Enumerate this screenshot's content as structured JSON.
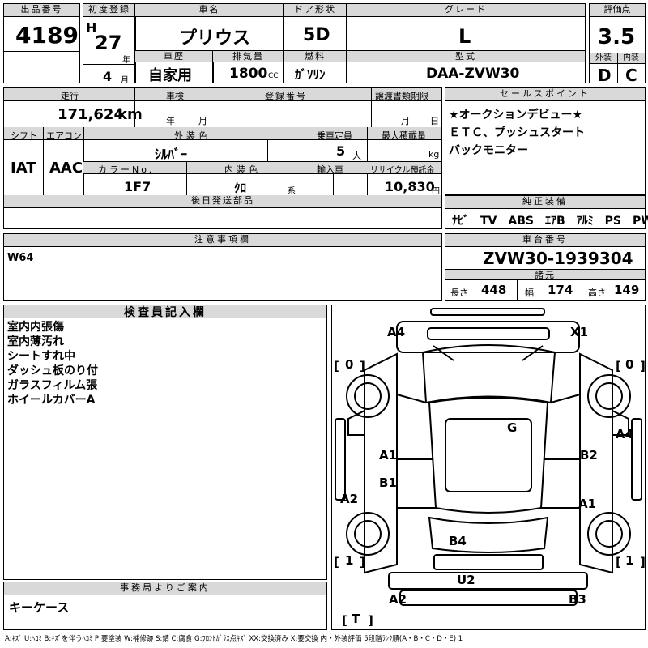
{
  "header": {
    "lot_no_label": "出品番号",
    "lot_no": "4189",
    "first_reg_label": "初度登録",
    "era": "H",
    "year": "27",
    "year_unit": "年",
    "month": "4",
    "month_unit": "月",
    "car_name_label": "車名",
    "car_name": "プリウス",
    "door_label": "ドア形状",
    "door": "5D",
    "grade_label": "グレード",
    "grade": "L",
    "rating_label": "評価点",
    "rating": "3.5",
    "history_label": "車歴",
    "history": "自家用",
    "displacement_label": "排気量",
    "displacement": "1800",
    "displacement_unit": "CC",
    "fuel_label": "燃料",
    "fuel": "ｶﾞｿﾘﾝ",
    "model_label": "型式",
    "model": "DAA-ZVW30",
    "exterior_label": "外装",
    "exterior": "D",
    "interior_label": "内装",
    "interior": "C"
  },
  "details": {
    "mileage_label": "走行",
    "mileage": "171,624",
    "mileage_unit": "km",
    "inspection_label": "車検",
    "insp_year_unit": "年",
    "insp_month_unit": "月",
    "reg_no_label": "登録番号",
    "transfer_label": "譲渡書類期限",
    "transfer_month_unit": "月",
    "transfer_day_unit": "日",
    "shift_label": "シフト",
    "shift": "IAT",
    "ac_label": "エアコン",
    "ac": "AAC",
    "color_label": "外装色",
    "color": "ｼﾙﾊﾞｰ",
    "capacity_label": "乗車定員",
    "capacity": "5",
    "capacity_unit": "人",
    "maxload_label": "最大積載量",
    "maxload_unit": "kg",
    "color_no_label": "カラーNo.",
    "color_no": "1F7",
    "int_color_label": "内装色",
    "int_color": "ｸﾛ",
    "int_color_unit": "系",
    "import_label": "輸入車",
    "recycle_label": "リサイクル預託金",
    "recycle": "10,830",
    "recycle_unit": "円",
    "later_parts_label": "後日発送部品",
    "notes_label": "注意事項欄",
    "notes_text": "W64"
  },
  "sales": {
    "label": "セールスポイント",
    "lines": [
      "★オークションデビュー★",
      "ＥＴＣ、プッシュスタート",
      "バックモニター"
    ]
  },
  "equipment": {
    "label": "純正装備",
    "items": "ﾅﾋﾞ　TV　ABS　ｴｱB　ｱﾙﾐ　PS　PW"
  },
  "chassis": {
    "label": "車台番号",
    "number": "ZVW30-1939304",
    "spec_label": "諸元",
    "length_label": "長さ",
    "length": "448",
    "width_label": "幅",
    "width": "174",
    "height_label": "高さ",
    "height": "149"
  },
  "inspector": {
    "label": "検査員記入欄",
    "lines": [
      "室内内張傷",
      "室内薄汚れ",
      "シートすれ中",
      "ダッシュ板のり付",
      "ガラスフィルム張",
      "ホイールカバーA"
    ]
  },
  "office": {
    "label": "事務局よりご案内",
    "text": "キーケース"
  },
  "diagram": {
    "marks": {
      "a4_tl": "A4",
      "x1": "X1",
      "g": "G",
      "a4_r": "A4",
      "a1_l": "A1",
      "b2": "B2",
      "b1": "B1",
      "a2_l": "A2",
      "a1_r": "A1",
      "b4": "B4",
      "u2": "U2",
      "a2_b": "A2",
      "b3": "B3",
      "zero_l": "0",
      "zero_r": "0",
      "one_l": "1",
      "one_r": "1",
      "t": "T"
    }
  },
  "legend": "A:ｷｽﾞ U:ﾍｺﾐ B:ｷｽﾞを伴うﾍｺﾐ P:要塗装 W:補修跡 S:錆 C:腐食 G:ﾌﾛﾝﾄｶﾞﾗｽ点ｷｽﾞ XX:交換済み X:要交換 内・外装評価 5段階ﾗﾝｸ順(A・B・C・D・E) 1"
}
